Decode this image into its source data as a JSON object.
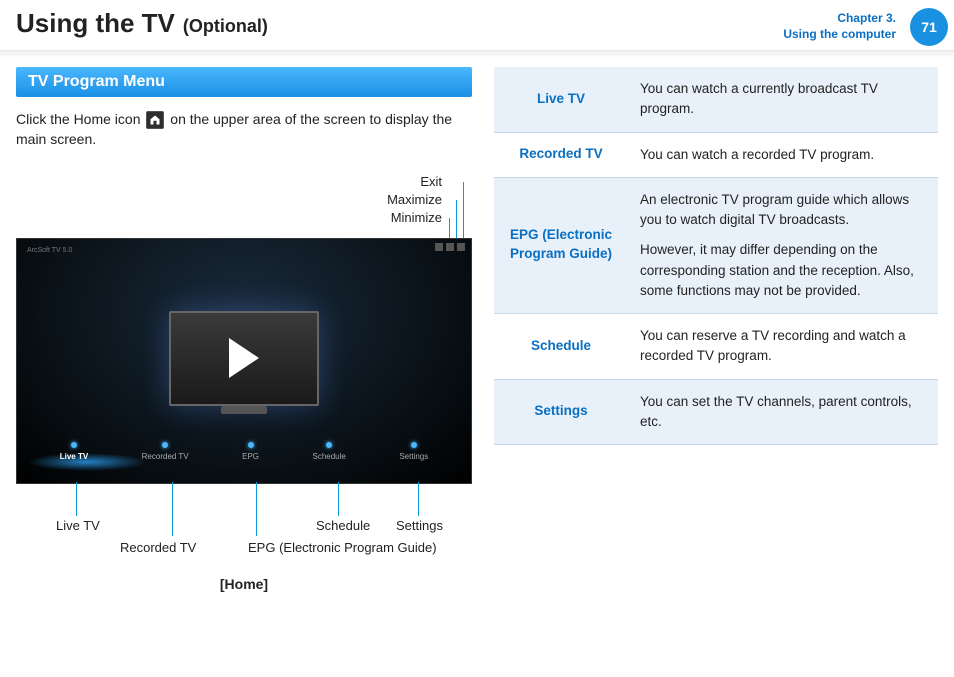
{
  "header": {
    "title": "Using the TV",
    "subtitle": "(Optional)",
    "chapter_line1": "Chapter 3.",
    "chapter_line2": "Using the computer",
    "page_number": "71"
  },
  "section": {
    "bar_title": "TV Program Menu",
    "intro_before": "Click the Home icon ",
    "intro_after": " on the upper area of the screen to display the main screen."
  },
  "window_controls": {
    "exit": "Exit",
    "maximize": "Maximize",
    "minimize": "Minimize"
  },
  "tv_screen": {
    "top_text": "ArcSoft TV 5.0",
    "menu_items": [
      "Live TV",
      "Recorded TV",
      "EPG",
      "Schedule",
      "Settings"
    ]
  },
  "callouts": {
    "live_tv": "Live TV",
    "recorded_tv": "Recorded TV",
    "epg": "EPG (Electronic Program Guide)",
    "schedule": "Schedule",
    "settings": "Settings",
    "home_caption": "[Home]"
  },
  "features": [
    {
      "label": "Live TV",
      "desc": [
        "You can watch a currently broadcast TV program."
      ]
    },
    {
      "label": "Recorded TV",
      "desc": [
        "You can watch a recorded TV program."
      ]
    },
    {
      "label": "EPG (Electronic Program Guide)",
      "desc": [
        "An electronic TV program guide which allows you to watch digital TV broadcasts.",
        "However, it may differ depending on the corresponding station and the reception. Also, some functions may not be provided."
      ]
    },
    {
      "label": "Schedule",
      "desc": [
        "You can reserve a TV recording and watch a recorded TV program."
      ]
    },
    {
      "label": "Settings",
      "desc": [
        "You can set the TV channels, parent controls, etc."
      ]
    }
  ]
}
